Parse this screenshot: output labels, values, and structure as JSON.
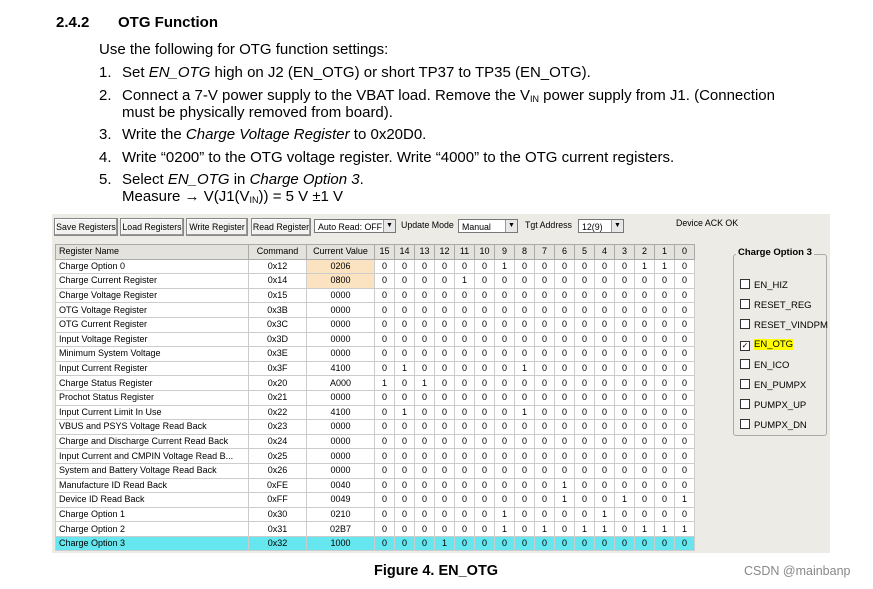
{
  "section": {
    "number": "2.4.2",
    "title": "OTG Function",
    "intro": "Use the following for OTG function settings:",
    "steps": [
      {
        "n": "1.",
        "parts": [
          "Set ",
          "EN_OTG",
          " high on J2 (EN_OTG) or short TP37 to TP35 (EN_OTG)."
        ]
      },
      {
        "n": "2.",
        "parts": [
          "Connect a 7-V power supply to the VBAT load. Remove the V",
          "IN",
          " power supply from J1. (Connection"
        ],
        "cont": "must be physically removed from board)."
      },
      {
        "n": "3.",
        "parts": [
          "Write the ",
          "Charge Voltage Register",
          " to 0x20D0."
        ]
      },
      {
        "n": "4.",
        "parts": [
          "Write “0200” to the OTG voltage register. Write “4000” to the OTG current registers."
        ]
      },
      {
        "n": "5.",
        "parts": [
          "Select ",
          "EN_OTG",
          " in ",
          "Charge Option 3",
          "."
        ],
        "cont_parts": [
          "Measure → V(J1(V",
          "IN",
          ")) = 5 V ±1 V"
        ]
      }
    ]
  },
  "toolbar": {
    "save": "Save Registers",
    "load": "Load Registers",
    "write": "Write Register",
    "read": "Read Register",
    "auto_read": "Auto Read: OFF",
    "update_mode_label": "Update Mode",
    "update_mode": "Manual",
    "tgt_label": "Tgt Address",
    "tgt_value": "12(9)",
    "status": "Device ACK OK"
  },
  "table": {
    "headers": [
      "Register Name",
      "Command",
      "Current Value",
      "15",
      "14",
      "13",
      "12",
      "11",
      "10",
      "9",
      "8",
      "7",
      "6",
      "5",
      "4",
      "3",
      "2",
      "1",
      "0"
    ],
    "rows": [
      [
        "Charge Option 0",
        "0x12",
        "0206",
        "0",
        "0",
        "0",
        "0",
        "0",
        "0",
        "1",
        "0",
        "0",
        "0",
        "0",
        "0",
        "0",
        "1",
        "1",
        "0"
      ],
      [
        "Charge Current Register",
        "0x14",
        "0800",
        "0",
        "0",
        "0",
        "0",
        "1",
        "0",
        "0",
        "0",
        "0",
        "0",
        "0",
        "0",
        "0",
        "0",
        "0",
        "0"
      ],
      [
        "Charge Voltage Register",
        "0x15",
        "0000",
        "0",
        "0",
        "0",
        "0",
        "0",
        "0",
        "0",
        "0",
        "0",
        "0",
        "0",
        "0",
        "0",
        "0",
        "0",
        "0"
      ],
      [
        "OTG Voltage Register",
        "0x3B",
        "0000",
        "0",
        "0",
        "0",
        "0",
        "0",
        "0",
        "0",
        "0",
        "0",
        "0",
        "0",
        "0",
        "0",
        "0",
        "0",
        "0"
      ],
      [
        "OTG Current Register",
        "0x3C",
        "0000",
        "0",
        "0",
        "0",
        "0",
        "0",
        "0",
        "0",
        "0",
        "0",
        "0",
        "0",
        "0",
        "0",
        "0",
        "0",
        "0"
      ],
      [
        "Input Voltage Register",
        "0x3D",
        "0000",
        "0",
        "0",
        "0",
        "0",
        "0",
        "0",
        "0",
        "0",
        "0",
        "0",
        "0",
        "0",
        "0",
        "0",
        "0",
        "0"
      ],
      [
        "Minimum System Voltage",
        "0x3E",
        "0000",
        "0",
        "0",
        "0",
        "0",
        "0",
        "0",
        "0",
        "0",
        "0",
        "0",
        "0",
        "0",
        "0",
        "0",
        "0",
        "0"
      ],
      [
        "Input Current Register",
        "0x3F",
        "4100",
        "0",
        "1",
        "0",
        "0",
        "0",
        "0",
        "0",
        "1",
        "0",
        "0",
        "0",
        "0",
        "0",
        "0",
        "0",
        "0"
      ],
      [
        "Charge Status Register",
        "0x20",
        "A000",
        "1",
        "0",
        "1",
        "0",
        "0",
        "0",
        "0",
        "0",
        "0",
        "0",
        "0",
        "0",
        "0",
        "0",
        "0",
        "0"
      ],
      [
        "Prochot Status Register",
        "0x21",
        "0000",
        "0",
        "0",
        "0",
        "0",
        "0",
        "0",
        "0",
        "0",
        "0",
        "0",
        "0",
        "0",
        "0",
        "0",
        "0",
        "0"
      ],
      [
        "Input Current Limit In Use",
        "0x22",
        "4100",
        "0",
        "1",
        "0",
        "0",
        "0",
        "0",
        "0",
        "1",
        "0",
        "0",
        "0",
        "0",
        "0",
        "0",
        "0",
        "0"
      ],
      [
        "VBUS and PSYS Voltage Read Back",
        "0x23",
        "0000",
        "0",
        "0",
        "0",
        "0",
        "0",
        "0",
        "0",
        "0",
        "0",
        "0",
        "0",
        "0",
        "0",
        "0",
        "0",
        "0"
      ],
      [
        "Charge and Discharge Current Read Back",
        "0x24",
        "0000",
        "0",
        "0",
        "0",
        "0",
        "0",
        "0",
        "0",
        "0",
        "0",
        "0",
        "0",
        "0",
        "0",
        "0",
        "0",
        "0"
      ],
      [
        "Input Current and CMPIN Voltage Read B...",
        "0x25",
        "0000",
        "0",
        "0",
        "0",
        "0",
        "0",
        "0",
        "0",
        "0",
        "0",
        "0",
        "0",
        "0",
        "0",
        "0",
        "0",
        "0"
      ],
      [
        "System and Battery Voltage Read Back",
        "0x26",
        "0000",
        "0",
        "0",
        "0",
        "0",
        "0",
        "0",
        "0",
        "0",
        "0",
        "0",
        "0",
        "0",
        "0",
        "0",
        "0",
        "0"
      ],
      [
        "Manufacture ID Read Back",
        "0xFE",
        "0040",
        "0",
        "0",
        "0",
        "0",
        "0",
        "0",
        "0",
        "0",
        "0",
        "1",
        "0",
        "0",
        "0",
        "0",
        "0",
        "0"
      ],
      [
        "Device ID Read Back",
        "0xFF",
        "0049",
        "0",
        "0",
        "0",
        "0",
        "0",
        "0",
        "0",
        "0",
        "0",
        "1",
        "0",
        "0",
        "1",
        "0",
        "0",
        "1"
      ],
      [
        "Charge Option 1",
        "0x30",
        "0210",
        "0",
        "0",
        "0",
        "0",
        "0",
        "0",
        "1",
        "0",
        "0",
        "0",
        "0",
        "1",
        "0",
        "0",
        "0",
        "0"
      ],
      [
        "Charge Option 2",
        "0x31",
        "02B7",
        "0",
        "0",
        "0",
        "0",
        "0",
        "0",
        "1",
        "0",
        "1",
        "0",
        "1",
        "1",
        "0",
        "1",
        "1",
        "1"
      ],
      [
        "Charge Option 3",
        "0x32",
        "1000",
        "0",
        "0",
        "0",
        "1",
        "0",
        "0",
        "0",
        "0",
        "0",
        "0",
        "0",
        "0",
        "0",
        "0",
        "0",
        "0"
      ]
    ]
  },
  "panel": {
    "title": "Charge Option 3",
    "options": [
      {
        "label": "EN_HIZ",
        "checked": false
      },
      {
        "label": "RESET_REG",
        "checked": false
      },
      {
        "label": "RESET_VINDPM",
        "checked": false
      },
      {
        "label": "EN_OTG",
        "checked": true
      },
      {
        "label": "EN_ICO",
        "checked": false
      },
      {
        "label": "EN_PUMPX",
        "checked": false
      },
      {
        "label": "PUMPX_UP",
        "checked": false
      },
      {
        "label": "PUMPX_DN",
        "checked": false
      }
    ]
  },
  "caption": "Figure 4. EN_OTG",
  "watermark": "CSDN @mainbanp",
  "colors": {
    "selected_row": "#66e6ee",
    "highlight_value": "#fbe2c0",
    "highlight_bit": "#ffff00"
  }
}
